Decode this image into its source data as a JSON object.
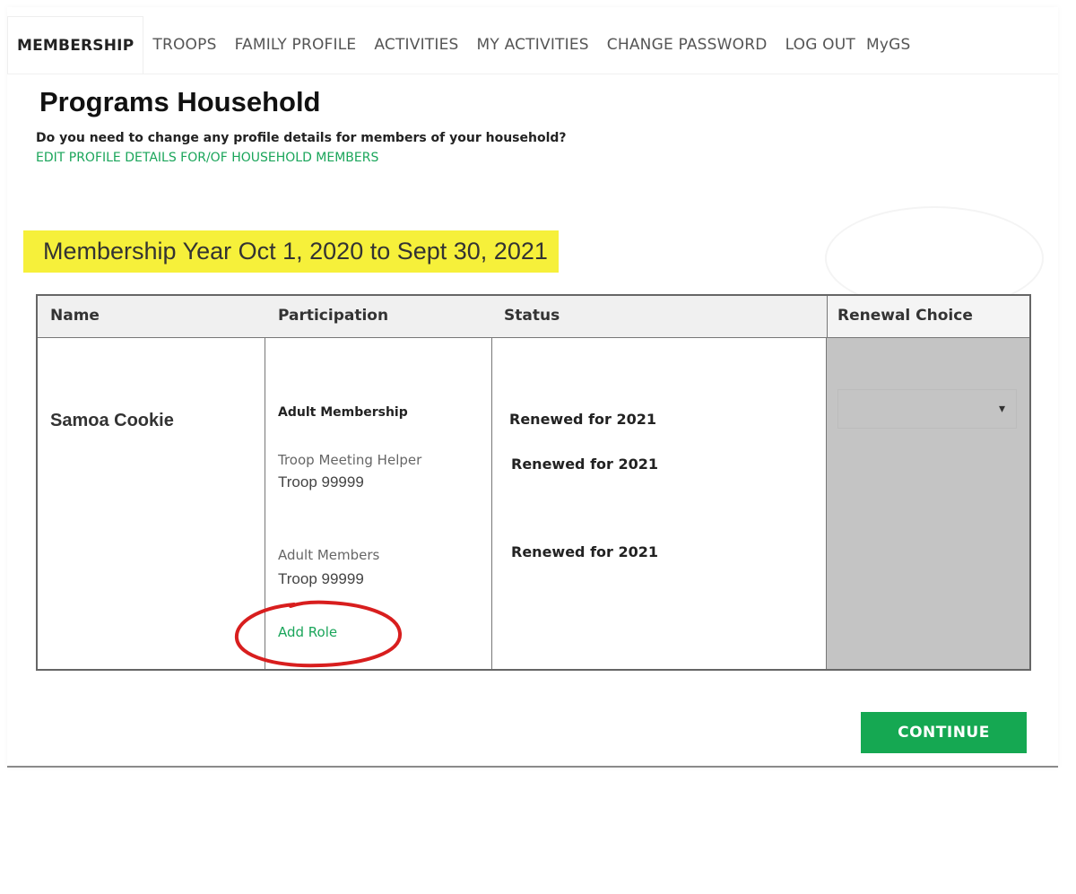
{
  "nav": {
    "items": [
      {
        "label": "MEMBERSHIP"
      },
      {
        "label": "TROOPS"
      },
      {
        "label": "FAMILY PROFILE"
      },
      {
        "label": "ACTIVITIES"
      },
      {
        "label": "MY ACTIVITIES"
      },
      {
        "label": "CHANGE PASSWORD"
      },
      {
        "label": "LOG OUT"
      },
      {
        "label": "MyGS"
      }
    ]
  },
  "page": {
    "title": "Programs Household",
    "question": "Do you need to change any profile details for members of your household?",
    "edit_link": "EDIT PROFILE DETAILS FOR/OF HOUSEHOLD MEMBERS",
    "membership_year": "Membership Year Oct 1, 2020 to Sept 30, 2021"
  },
  "table": {
    "headers": {
      "name": "Name",
      "participation": "Participation",
      "status": "Status",
      "renewal": "Renewal Choice"
    },
    "member": {
      "name": "Samoa Cookie",
      "participation": [
        {
          "role": "Adult Membership",
          "troop": ""
        },
        {
          "role": "Troop Meeting Helper",
          "troop": "Troop 99999"
        },
        {
          "role": "Adult Members",
          "troop": "Troop 99999"
        }
      ],
      "statuses": [
        "Renewed for 2021",
        "Renewed for 2021",
        "Renewed for 2021"
      ],
      "add_role": "Add Role",
      "renewal_caret": "▾"
    }
  },
  "actions": {
    "continue": "CONTINUE"
  },
  "colors": {
    "accent_green": "#15a852",
    "link_green": "#1aa55a",
    "highlight_yellow": "#f6f03a",
    "annotation_red": "#d81e1e"
  }
}
